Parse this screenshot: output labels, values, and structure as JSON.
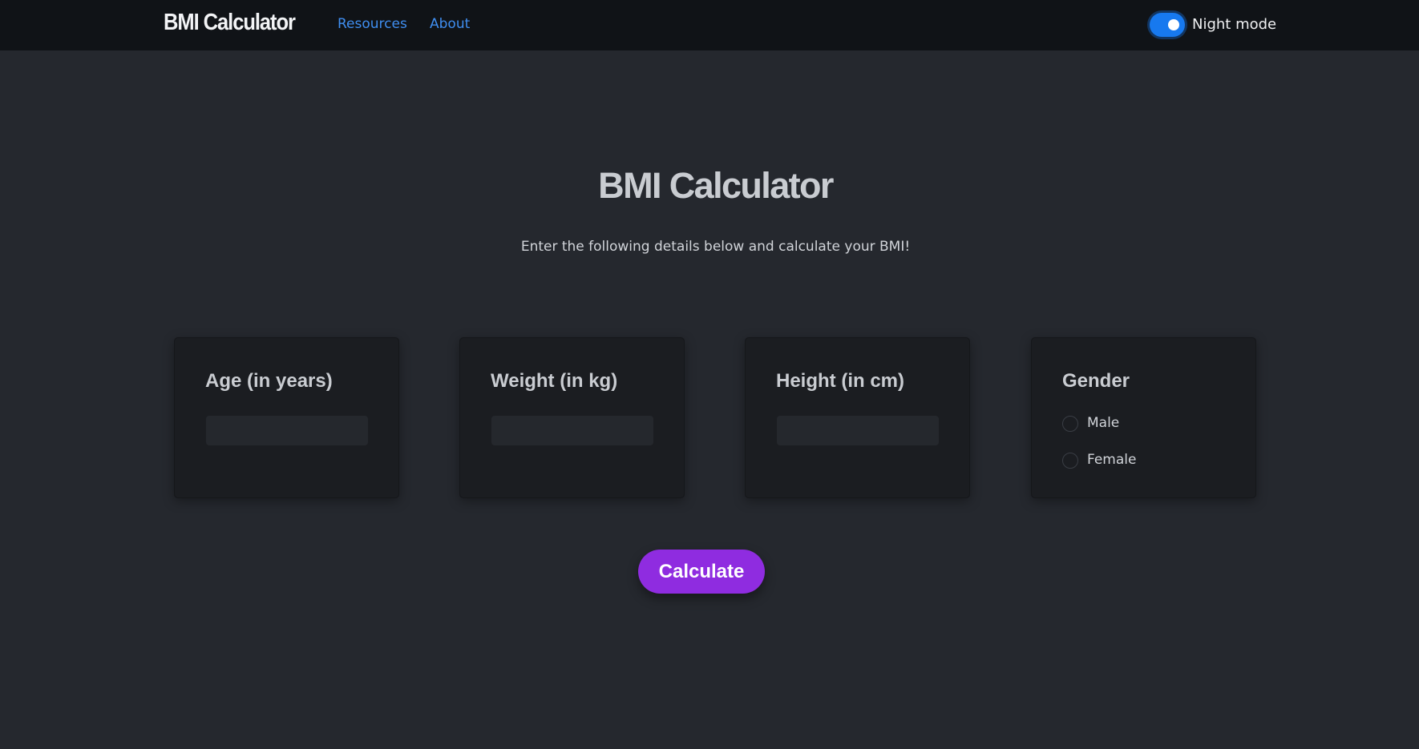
{
  "navbar": {
    "brand": "BMI Calculator",
    "links": [
      {
        "label": "Resources"
      },
      {
        "label": "About"
      }
    ],
    "night_mode": {
      "label": "Night mode",
      "enabled": true
    }
  },
  "main": {
    "title": "BMI Calculator",
    "subtitle": "Enter the following details below and calculate your BMI!",
    "cards": {
      "age": {
        "title": "Age (in years)",
        "value": ""
      },
      "weight": {
        "title": "Weight (in kg)",
        "value": ""
      },
      "height": {
        "title": "Height (in cm)",
        "value": ""
      },
      "gender": {
        "title": "Gender",
        "options": [
          {
            "label": "Male",
            "selected": false
          },
          {
            "label": "Female",
            "selected": false
          }
        ]
      }
    },
    "calculate_label": "Calculate"
  },
  "colors": {
    "background": "#25282e",
    "navbar": "#101317",
    "card": "#1b1d21",
    "link": "#3f8ef0",
    "toggle": "#1779ef",
    "button": "#8f2ce0"
  }
}
